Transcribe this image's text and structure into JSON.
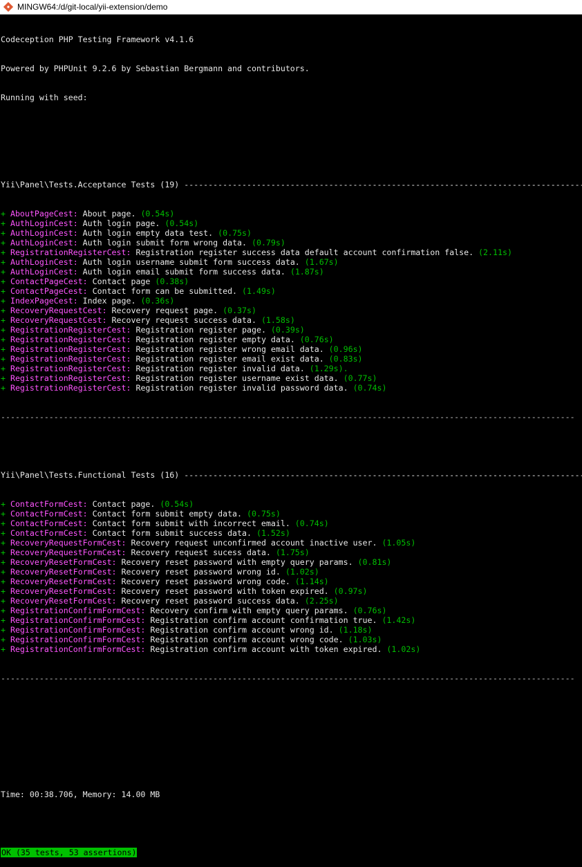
{
  "window": {
    "title": "MINGW64:/d/git-local/yii-extension/demo"
  },
  "header_lines": [
    "Codeception PHP Testing Framework v4.1.6",
    "Powered by PHPUnit 9.2.6 by Sebastian Bergmann and contributors.",
    "Running with seed:"
  ],
  "acceptance": {
    "heading": "Yii\\Panel\\Tests.Acceptance Tests (19)",
    "rule": "-----------------------------------------------------------------------------------------------------",
    "tests": [
      {
        "cest": "AboutPageCest:",
        "desc": " About page.",
        "time": " (0.54s)"
      },
      {
        "cest": "AuthLoginCest:",
        "desc": " Auth login page.",
        "time": " (0.54s)"
      },
      {
        "cest": "AuthLoginCest:",
        "desc": " Auth login empty data test.",
        "time": " (0.75s)"
      },
      {
        "cest": "AuthLoginCest:",
        "desc": " Auth login submit form wrong data.",
        "time": " (0.79s)"
      },
      {
        "cest": "RegistrationRegisterCest:",
        "desc": " Registration register success data default account confirmation false.",
        "time": " (2.11s)"
      },
      {
        "cest": "AuthLoginCest:",
        "desc": " Auth login username submit form success data.",
        "time": " (1.67s)"
      },
      {
        "cest": "AuthLoginCest:",
        "desc": " Auth login email submit form success data.",
        "time": " (1.87s)"
      },
      {
        "cest": "ContactPageCest:",
        "desc": " Contact page",
        "time": " (0.38s)"
      },
      {
        "cest": "ContactPageCest:",
        "desc": " Contact form can be submitted.",
        "time": " (1.49s)"
      },
      {
        "cest": "IndexPageCest:",
        "desc": " Index page.",
        "time": " (0.36s)"
      },
      {
        "cest": "RecoveryRequestCest:",
        "desc": " Recovery request page.",
        "time": " (0.37s)"
      },
      {
        "cest": "RecoveryRequestCest:",
        "desc": " Recovery request success data.",
        "time": " (1.58s)"
      },
      {
        "cest": "RegistrationRegisterCest:",
        "desc": " Registration register page.",
        "time": " (0.39s)"
      },
      {
        "cest": "RegistrationRegisterCest:",
        "desc": " Registration register empty data.",
        "time": " (0.76s)"
      },
      {
        "cest": "RegistrationRegisterCest:",
        "desc": " Registration register wrong email data.",
        "time": " (0.96s)"
      },
      {
        "cest": "RegistrationRegisterCest:",
        "desc": " Registration register email exist data.",
        "time": " (0.83s)"
      },
      {
        "cest": "RegistrationRegisterCest:",
        "desc": " Registration register invalid data.",
        "time": " (1.29s)."
      },
      {
        "cest": "RegistrationRegisterCest:",
        "desc": " Registration register username exist data.",
        "time": " (0.77s)"
      },
      {
        "cest": "RegistrationRegisterCest:",
        "desc": " Registration register invalid password data.",
        "time": " (0.74s)"
      }
    ]
  },
  "functional": {
    "heading": "Yii\\Panel\\Tests.Functional Tests (16)",
    "rule": "-----------------------------------------------------------------------------------------------------",
    "tests": [
      {
        "cest": "ContactFormCest:",
        "desc": " Contact page.",
        "time": " (0.54s)"
      },
      {
        "cest": "ContactFormCest:",
        "desc": " Contact form submit empty data.",
        "time": " (0.75s)"
      },
      {
        "cest": "ContactFormCest:",
        "desc": " Contact form submit with incorrect email.",
        "time": " (0.74s)"
      },
      {
        "cest": "ContactFormCest:",
        "desc": " Contact form submit success data.",
        "time": " (1.52s)"
      },
      {
        "cest": "RecoveryRequestFormCest:",
        "desc": " Recovery request unconfirmed account inactive user.",
        "time": " (1.05s)"
      },
      {
        "cest": "RecoveryRequestFormCest:",
        "desc": " Recovery request sucess data.",
        "time": " (1.75s)"
      },
      {
        "cest": "RecoveryResetFormCest:",
        "desc": " Recovery reset password with empty query params.",
        "time": " (0.81s)"
      },
      {
        "cest": "RecoveryResetFormCest:",
        "desc": " Recovery reset password wrong id.",
        "time": " (1.02s)"
      },
      {
        "cest": "RecoveryResetFormCest:",
        "desc": " Recovery reset password wrong code.",
        "time": " (1.14s)"
      },
      {
        "cest": "RecoveryResetFormCest:",
        "desc": " Recovery reset password with token expired.",
        "time": " (0.97s)"
      },
      {
        "cest": "RecoveryResetFormCest:",
        "desc": " Recovery reset password success data.",
        "time": " (2.25s)"
      },
      {
        "cest": "RegistrationConfirmFormCest:",
        "desc": " Recovery confirm with empty query params.",
        "time": " (0.76s)"
      },
      {
        "cest": "RegistrationConfirmFormCest:",
        "desc": " Registration confirm account confirmation true.",
        "time": " (1.42s)"
      },
      {
        "cest": "RegistrationConfirmFormCest:",
        "desc": " Registration confirm account wrong id.",
        "time": " (1.18s)"
      },
      {
        "cest": "RegistrationConfirmFormCest:",
        "desc": " Registration confirm account wrong code.",
        "time": " (1.03s)"
      },
      {
        "cest": "RegistrationConfirmFormCest:",
        "desc": " Registration confirm account with token expired.",
        "time": " (1.02s)"
      }
    ]
  },
  "footer_rule": "-----------------------------------------------------------------------------------------------------------------------",
  "summary": {
    "time_memory": "Time: 00:38.706, Memory: 14.00 MB",
    "result": "OK (35 tests, 53 assertions)"
  },
  "colors": {
    "background": "#000000",
    "pass": "#00c000",
    "cest": "#ff55ff",
    "text": "#c0c0c0"
  },
  "icons": {
    "app": "git-bash-icon"
  }
}
